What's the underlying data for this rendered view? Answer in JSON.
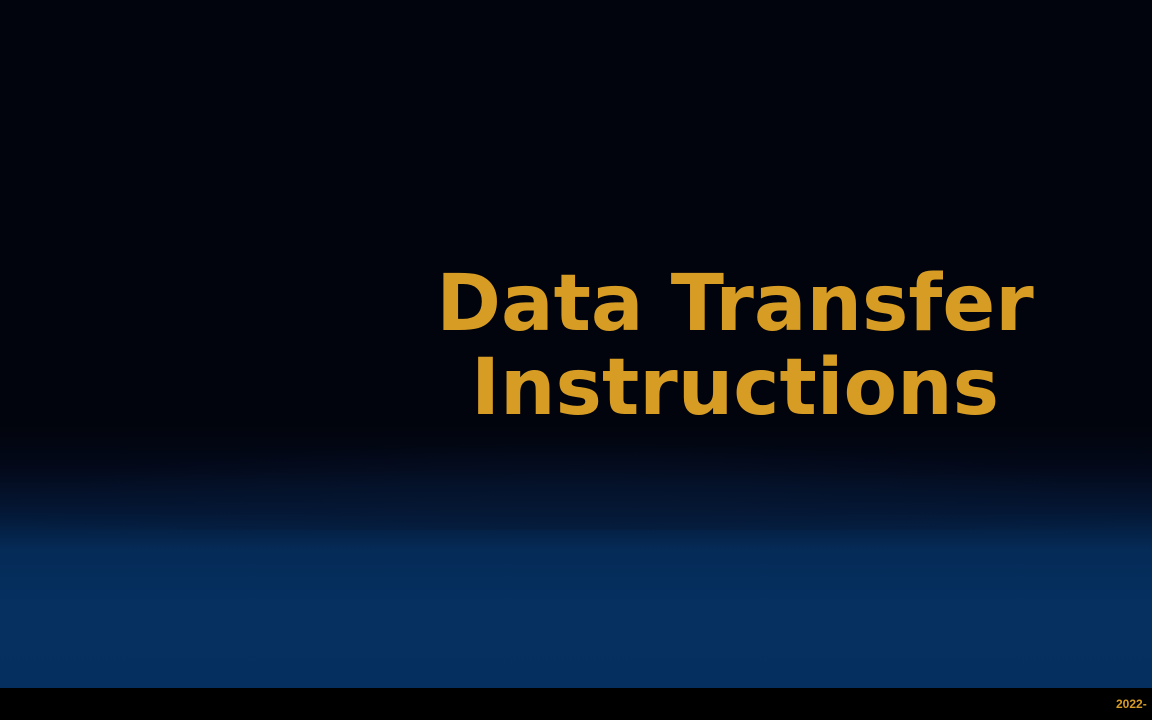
{
  "slide": {
    "title_line1": "Data Transfer",
    "title_line2": "Instructions",
    "footer_date": "2022-"
  },
  "colors": {
    "title": "#d79c24",
    "background_top": "#02040d",
    "background_bottom": "#052f5e",
    "footer_text": "#d79c24"
  }
}
